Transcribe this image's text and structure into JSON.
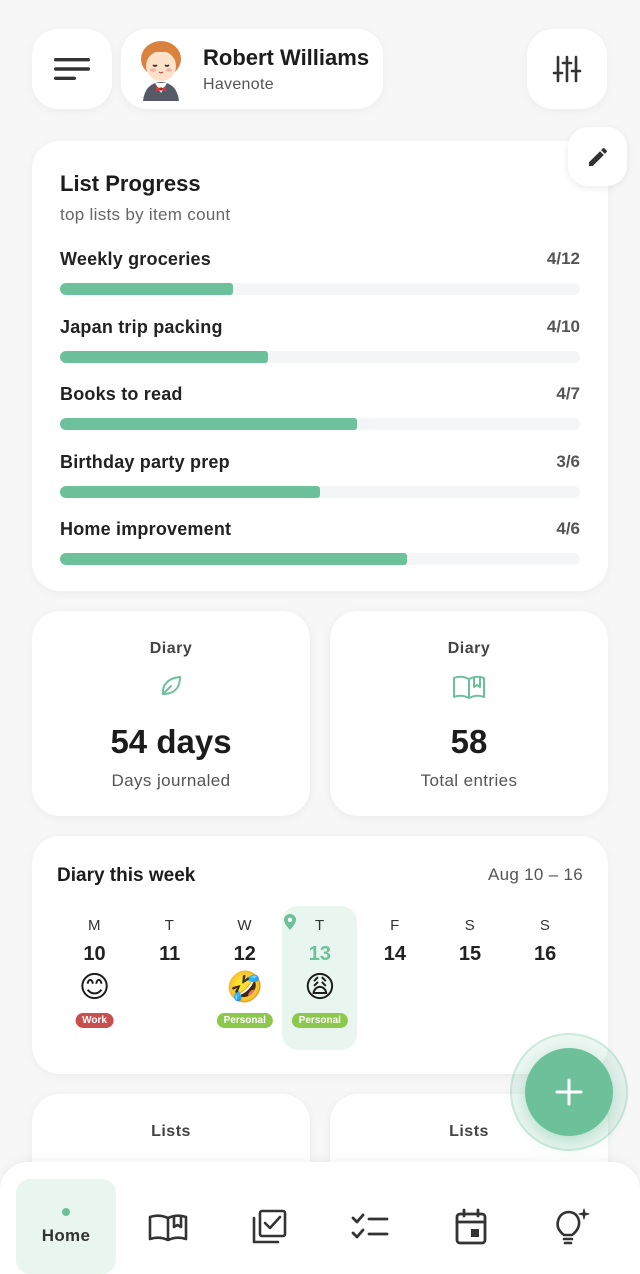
{
  "header": {
    "user_name": "Robert Williams",
    "app_name": "Havenote"
  },
  "list_progress": {
    "title": "List Progress",
    "subtitle": "top lists by item count",
    "items": [
      {
        "name": "Weekly groceries",
        "count": "4/12",
        "progress": 0.333
      },
      {
        "name": "Japan trip packing",
        "count": "4/10",
        "progress": 0.4
      },
      {
        "name": "Books to read",
        "count": "4/7",
        "progress": 0.571
      },
      {
        "name": "Birthday party prep",
        "count": "3/6",
        "progress": 0.5
      },
      {
        "name": "Home improvement",
        "count": "4/6",
        "progress": 0.667
      }
    ]
  },
  "stats": [
    {
      "label": "Diary",
      "icon": "leaf-icon",
      "value": "54 days",
      "caption": "Days journaled"
    },
    {
      "label": "Diary",
      "icon": "open-book-icon",
      "value": "58",
      "caption": "Total entries"
    }
  ],
  "week": {
    "title": "Diary this week",
    "range": "Aug 10 – 16",
    "days": [
      {
        "letter": "M",
        "num": "10",
        "emoji": "😊",
        "tag": "Work",
        "tag_color": "#c94f4f"
      },
      {
        "letter": "T",
        "num": "11",
        "emoji": "",
        "tag": "",
        "tag_color": ""
      },
      {
        "letter": "W",
        "num": "12",
        "emoji": "🤣",
        "tag": "Personal",
        "tag_color": "#8cc84b"
      },
      {
        "letter": "T",
        "num": "13",
        "emoji": "😩",
        "tag": "Personal",
        "tag_color": "#8cc84b",
        "today": true
      },
      {
        "letter": "F",
        "num": "14",
        "emoji": "",
        "tag": "",
        "tag_color": ""
      },
      {
        "letter": "S",
        "num": "15",
        "emoji": "",
        "tag": "",
        "tag_color": ""
      },
      {
        "letter": "S",
        "num": "16",
        "emoji": "",
        "tag": "",
        "tag_color": ""
      }
    ]
  },
  "lower_cards": [
    {
      "label": "Lists"
    },
    {
      "label": "Lists"
    }
  ],
  "nav": {
    "home_label": "Home"
  },
  "colors": {
    "accent": "#6cc19a",
    "accent_light": "#e9f6ef",
    "work_tag": "#c94f4f",
    "personal_tag": "#8cc84b"
  }
}
